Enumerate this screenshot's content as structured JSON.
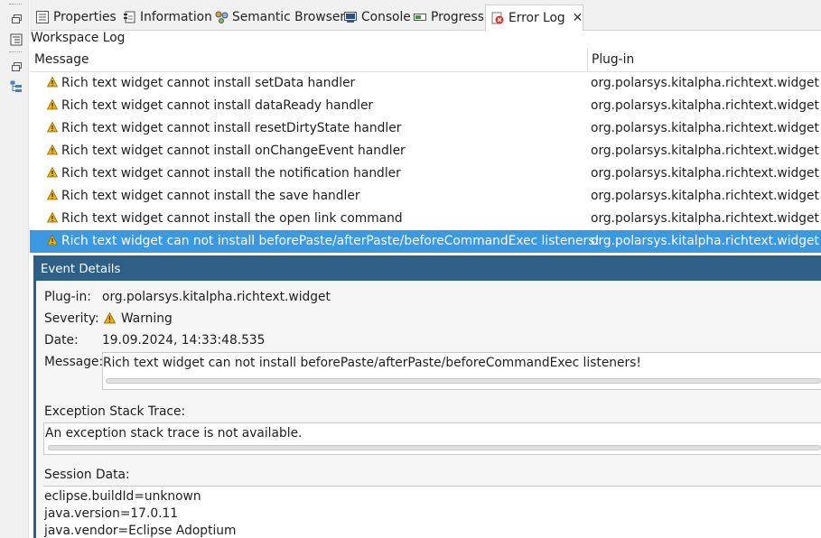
{
  "tabs": [
    {
      "label": "Properties",
      "icon": "properties-icon"
    },
    {
      "label": "Information",
      "icon": "information-icon"
    },
    {
      "label": "Semantic Browser",
      "icon": "semantic-browser-icon"
    },
    {
      "label": "Console",
      "icon": "console-icon"
    },
    {
      "label": "Progress",
      "icon": "progress-icon"
    },
    {
      "label": "Error Log",
      "icon": "error-log-icon",
      "active": true
    }
  ],
  "workspace_label": "Workspace Log",
  "table": {
    "columns": [
      "Message",
      "Plug-in"
    ],
    "rows": [
      {
        "message": "Rich text widget cannot install setData handler",
        "plugin": "org.polarsys.kitalpha.richtext.widget"
      },
      {
        "message": "Rich text widget cannot install dataReady handler",
        "plugin": "org.polarsys.kitalpha.richtext.widget"
      },
      {
        "message": "Rich text widget cannot install resetDirtyState handler",
        "plugin": "org.polarsys.kitalpha.richtext.widget"
      },
      {
        "message": "Rich text widget cannot install onChangeEvent handler",
        "plugin": "org.polarsys.kitalpha.richtext.widget"
      },
      {
        "message": "Rich text widget cannot install the notification handler",
        "plugin": "org.polarsys.kitalpha.richtext.widget"
      },
      {
        "message": "Rich text widget cannot install the save handler",
        "plugin": "org.polarsys.kitalpha.richtext.widget"
      },
      {
        "message": "Rich text widget cannot install the open link command",
        "plugin": "org.polarsys.kitalpha.richtext.widget"
      },
      {
        "message": "Rich text widget can not install beforePaste/afterPaste/beforeCommandExec listeners!",
        "plugin": "org.polarsys.kitalpha.richtext.widget",
        "selected": true
      }
    ]
  },
  "details": {
    "title": "Event Details",
    "plugin_label": "Plug-in:",
    "plugin_value": "org.polarsys.kitalpha.richtext.widget",
    "severity_label": "Severity:",
    "severity_value": "Warning",
    "date_label": "Date:",
    "date_value": "19.09.2024, 14:33:48.535",
    "message_label": "Message:",
    "message_value": "Rich text widget can not install beforePaste/afterPaste/beforeCommandExec listeners!",
    "stack_label": "Exception Stack Trace:",
    "stack_value": "An exception stack trace is not available.",
    "session_label": "Session Data:",
    "session_lines": [
      "eclipse.buildId=unknown",
      "java.version=17.0.11",
      "java.vendor=Eclipse Adoptium"
    ]
  },
  "colors": {
    "selection": "#3a99e1",
    "details_header": "#2d5f87",
    "warning": "#f0b400"
  }
}
